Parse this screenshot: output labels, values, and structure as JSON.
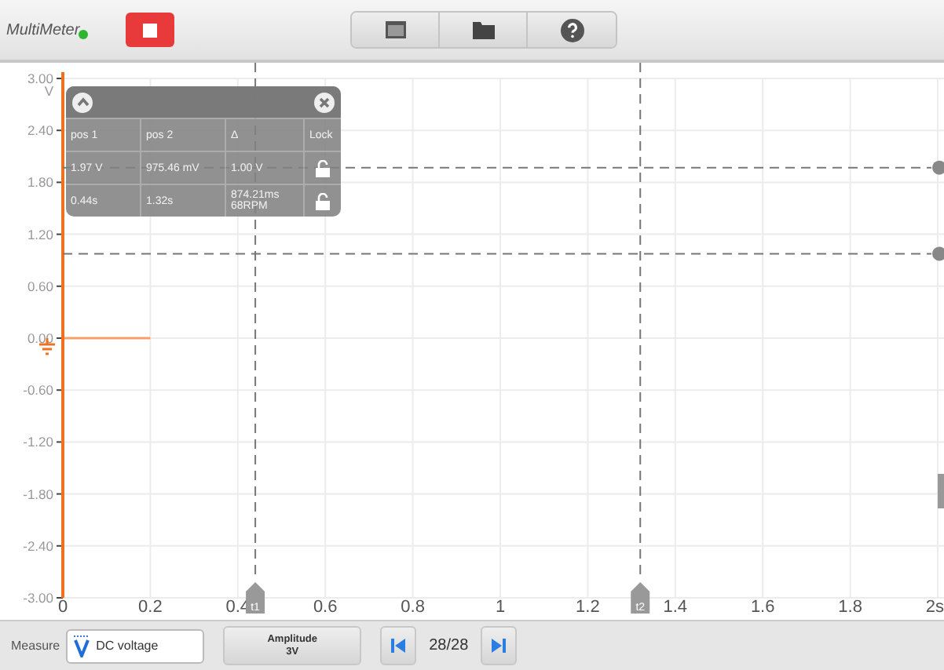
{
  "app": {
    "title": "MultiMeter",
    "connected": true
  },
  "toolbar": {
    "buttons": [
      {
        "kind": "window"
      },
      {
        "kind": "folder"
      },
      {
        "kind": "help"
      }
    ]
  },
  "plot": {
    "chart_data": {
      "type": "line",
      "ylabel": "V",
      "x": [
        0,
        0.2
      ],
      "series": [
        {
          "color": "#f5a06a",
          "values": [
            0,
            0
          ]
        }
      ],
      "xlim": [
        0,
        2
      ],
      "ylim": [
        -3,
        3
      ],
      "xticks": [
        0,
        0.2,
        0.4,
        0.6,
        0.8,
        1,
        1.2,
        1.4,
        1.6,
        1.8,
        {
          "value": 2,
          "label": "2s"
        }
      ],
      "yticks": [
        {
          "value": 3,
          "label": "3.00"
        },
        {
          "value": 2.4,
          "label": "2.40"
        },
        {
          "value": 1.8,
          "label": "1.80"
        },
        {
          "value": 1.2,
          "label": "1.20"
        },
        {
          "value": 0.6,
          "label": "0.60"
        },
        {
          "value": 0,
          "label": "0.00"
        },
        {
          "value": -0.6,
          "label": "-0.60"
        },
        {
          "value": -1.2,
          "label": "-1.20"
        },
        {
          "value": -1.8,
          "label": "-1.80"
        },
        {
          "value": -2.4,
          "label": "-2.40"
        },
        {
          "value": -3,
          "label": "-3.00"
        }
      ],
      "grid": true,
      "ref_lines": [
        {
          "axis": "x",
          "value": 0.44,
          "label": "t1"
        },
        {
          "axis": "x",
          "value": 1.32,
          "label": "t2"
        },
        {
          "axis": "y",
          "value": 1.97
        },
        {
          "axis": "y",
          "value": 0.975
        }
      ]
    }
  },
  "measurements": {
    "columns": [
      "pos 1",
      "pos 2",
      "Δ",
      "Lock"
    ],
    "rows": [
      {
        "cells": [
          "1.97 V",
          "975.46 mV",
          "1.00 V"
        ],
        "locked": false
      },
      {
        "cells": [
          "0.44s",
          "1.32s",
          "874.21ms 68RPM"
        ],
        "locked": false
      }
    ]
  },
  "bottom_bar": {
    "measure_label": "Measure",
    "measure_value": "DC voltage",
    "amplitude_title": "Amplitude",
    "amplitude_value": "3V",
    "page": "28/28"
  }
}
